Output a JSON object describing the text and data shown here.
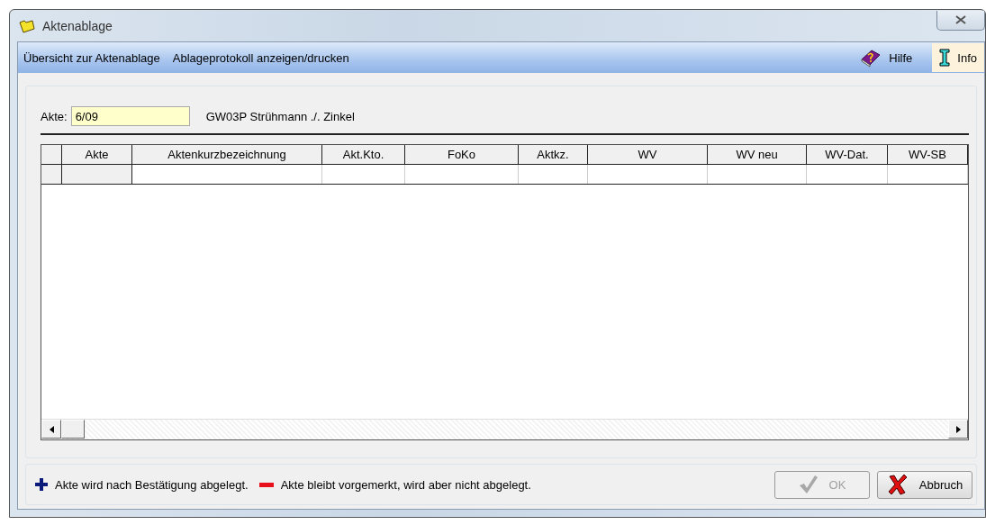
{
  "window": {
    "title": "Aktenablage"
  },
  "menu": [
    {
      "label": "Übersicht zur Aktenablage"
    },
    {
      "label": "Ablageprotokoll anzeigen/drucken"
    }
  ],
  "toolbar": [
    {
      "kind": "help",
      "label": "Hilfe",
      "highlighted": false
    },
    {
      "kind": "info",
      "label": "Info",
      "highlighted": true
    }
  ],
  "akte": {
    "label": "Akte:",
    "value": "6/09",
    "description": "GW03P Strühmann ./. Zinkel"
  },
  "table": {
    "columns": [
      "Akte",
      "Aktenkurzbezeichnung",
      "Akt.Kto.",
      "FoKo",
      "Aktkz.",
      "WV",
      "WV neu",
      "WV-Dat.",
      "WV-SB"
    ]
  },
  "legend": [
    {
      "kind": "plus",
      "text": "Akte wird nach Bestätigung abgelegt."
    },
    {
      "kind": "minus",
      "text": "Akte bleibt vorgemerkt, wird aber nicht abgelegt."
    }
  ],
  "buttons": [
    {
      "kind": "ok",
      "label": "OK",
      "disabled": true
    },
    {
      "kind": "cancel",
      "label": "Abbruch",
      "disabled": false
    }
  ]
}
